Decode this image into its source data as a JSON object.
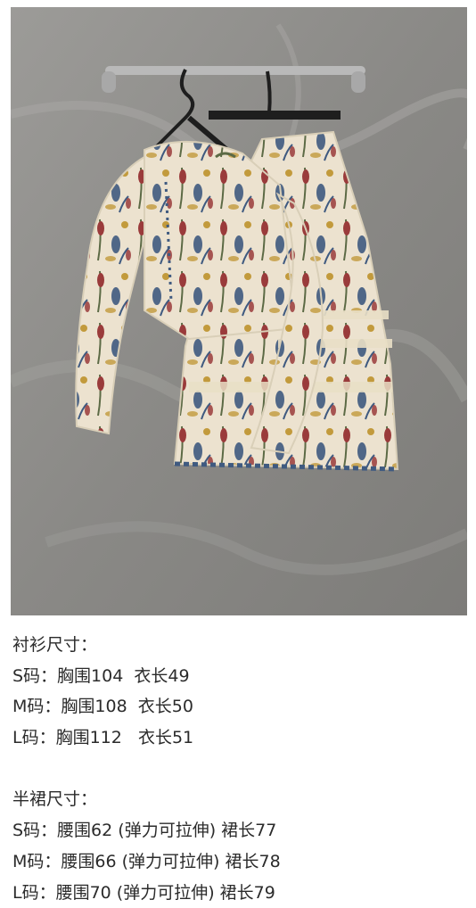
{
  "photo": {
    "subject": "floral print blouse and skirt on hangers",
    "colors": {
      "wall": "#8e8d8a",
      "rail": "#b9b9b9",
      "fabric_base": "#ece2cf",
      "print_red": "#9a3b3b",
      "print_blue": "#3f5a80",
      "print_gold": "#c29a3c",
      "print_green": "#5c6a45"
    }
  },
  "shirt": {
    "title": "衬衫尺寸：",
    "sizes": [
      {
        "label": "S码：胸围104  衣长49"
      },
      {
        "label": "M码：胸围108  衣长50"
      },
      {
        "label": "L码：胸围112   衣长51"
      }
    ]
  },
  "skirt": {
    "title": "半裙尺寸：",
    "sizes": [
      {
        "label": "S码：腰围62 (弹力可拉伸) 裙长77"
      },
      {
        "label": "M码：腰围66 (弹力可拉伸) 裙长78"
      },
      {
        "label": "L码：腰围70 (弹力可拉伸) 裙长79"
      }
    ]
  }
}
